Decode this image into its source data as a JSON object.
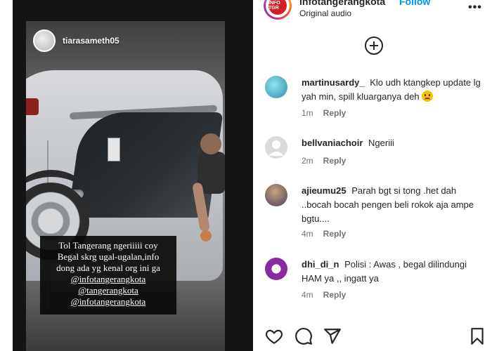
{
  "post": {
    "username": "infotangerangkota",
    "follow_label": "Follow",
    "audio": "Original audio",
    "avatar_text": "INFO TGR"
  },
  "story": {
    "username": "tiarasameth05",
    "caption_lines": [
      "Tol Tangerang ngeriiiii coy",
      "Begal skrg ugal-ugalan,info",
      "dong ada yg kenal org ini ga"
    ],
    "tags": [
      "@infotangerangkota",
      "@tangerangkota",
      "@infotangerangkota"
    ]
  },
  "comments": [
    {
      "username": "martinusardy_",
      "text": "Klo udh ktangkep update lg yah min, spill kluarganya deh",
      "emoji": "sad-face",
      "time": "1m",
      "reply": "Reply",
      "avatar_color": "#3fa9c0"
    },
    {
      "username": "bellvaniachoir",
      "text": "Ngeriii",
      "time": "2m",
      "reply": "Reply",
      "avatar_color": "#dbdbdb"
    },
    {
      "username": "ajieumu25",
      "text": "Parah bgt si tong .het dah ..bocah bocah pengen beli rokok aja ampe bgtu....",
      "time": "4m",
      "reply": "Reply",
      "avatar_color": "#6b5a7a"
    },
    {
      "username": "dhi_di_n",
      "text": "Polisi : Awas , begal dilindungi HAM ya ,, ingatt ya",
      "time": "4m",
      "reply": "Reply",
      "avatar_color": "#7a2b8f"
    }
  ],
  "icons": {
    "add": "plus-circle-icon",
    "like": "heart-icon",
    "comment": "comment-icon",
    "share": "send-icon",
    "save": "bookmark-icon",
    "more": "more-icon"
  }
}
